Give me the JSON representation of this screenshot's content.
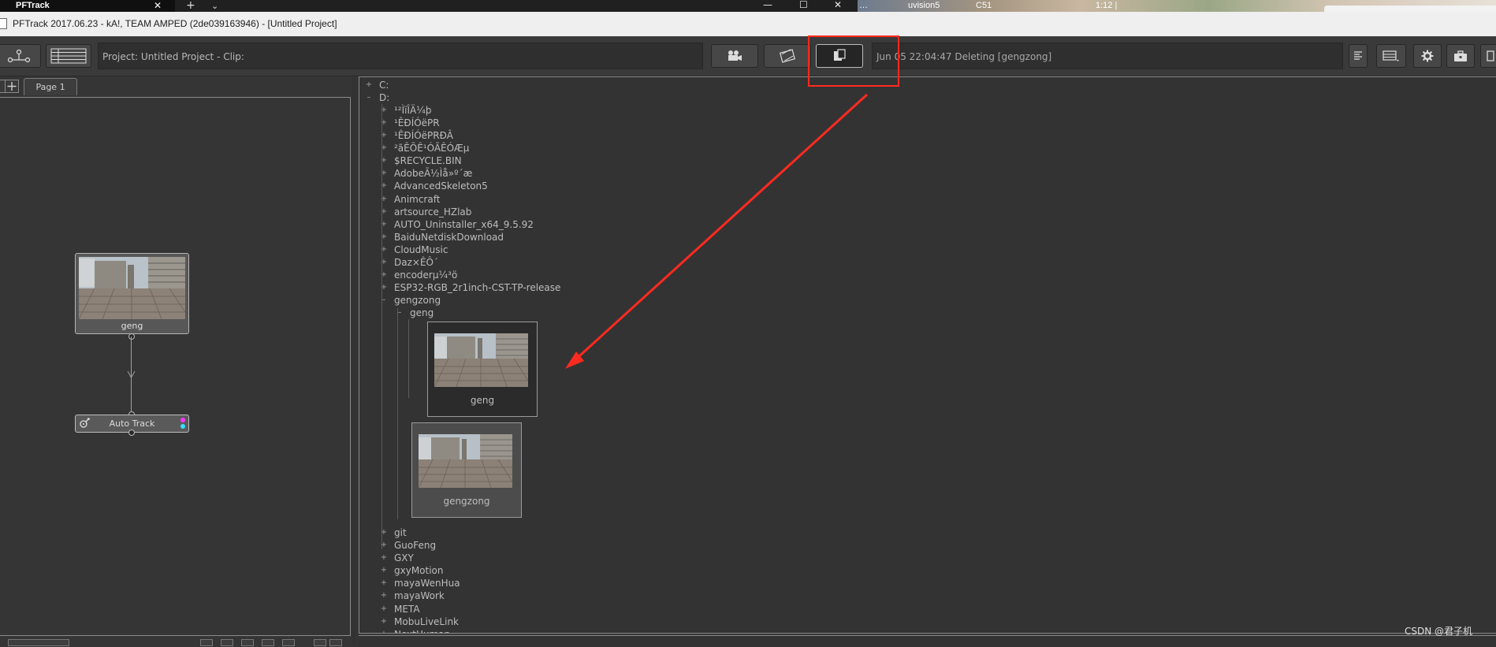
{
  "os": {
    "tab_label": "PFTrack",
    "tab_close": "✕",
    "new_tab": "+",
    "tab_menu": "⌄",
    "minimize": "—",
    "maximize": "☐",
    "close": "✕",
    "desktop_labels": [
      "…",
      "uvision5",
      "C51",
      "1:12 |"
    ]
  },
  "window": {
    "title": "PFTrack 2017.06.23 - kA!, TEAM AMPED (2de039163946) - [Untitled Project]"
  },
  "toolbar": {
    "project_clip_text": "Project: Untitled Project - Clip:",
    "status_text": "Jun 05 22:04:47 Deleting [gengzong]"
  },
  "left_panel": {
    "page_tab": "Page 1",
    "clip_node_label": "geng",
    "track_node_label": "Auto Track"
  },
  "tree": {
    "drives": [
      "C:",
      "D:"
    ],
    "folders_before": [
      "¹²ÌïÎÄ¼þ",
      "¹ÊÐÍÓëPR",
      "¹ÊÐÍÓëPRÐÂ",
      "²ãÊÕÊ¹ÓÃÊÓÆµ",
      "$RECYCLE.BIN",
      "AdobeÃ½Ìå»º´æ",
      "AdvancedSkeleton5",
      "Animcraft",
      "artsource_HZlab",
      "AUTO_Uninstaller_x64_9.5.92",
      "BaiduNetdiskDownload",
      "CloudMusic",
      "Daz×ÊÔ´",
      "encoderµ¼³ö",
      "ESP32-RGB_2r1inch-CST-TP-release"
    ],
    "expanded_folder": "gengzong",
    "expanded_subfolder": "geng",
    "clips": [
      "geng",
      "gengzong"
    ],
    "folders_after": [
      "git",
      "GuoFeng",
      "GXY",
      "gxyMotion",
      "mayaWenHua",
      "mayaWork",
      "META",
      "MobuLiveLink",
      "NextHuman"
    ],
    "expand_symbol": "+",
    "collapse_symbol": "–"
  },
  "watermark": "CSDN @君子机",
  "colors": {
    "panel_bg": "#333333",
    "annotation_red": "#ff2a1f",
    "port_magenta": "#ff33ff",
    "port_cyan": "#33e0ff"
  }
}
